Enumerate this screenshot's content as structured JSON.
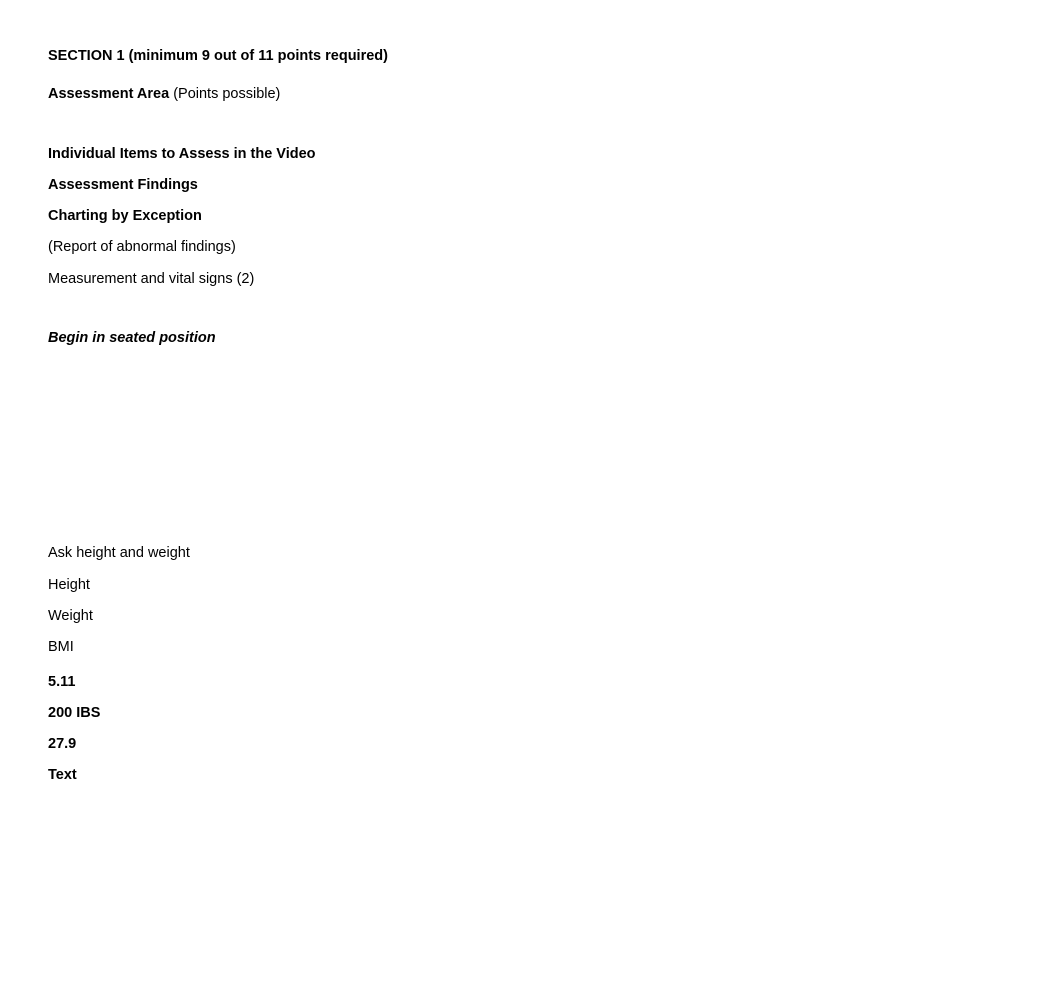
{
  "section_title": "SECTION 1 (minimum 9 out of 11 points required)",
  "assessment_area_label": "Assessment Area",
  "points_possible_label": " (Points possible)",
  "individual_items_label": "Individual Items to Assess in the Video",
  "assessment_findings_label": "Assessment Findings",
  "charting_exception_label": "Charting by Exception",
  "report_abnormal_label": "(Report of abnormal findings)",
  "measurement_vitals_label": "Measurement and vital signs (2)",
  "begin_position_label": "Begin in seated position",
  "ask_height_weight_label": "Ask height and weight",
  "fields": {
    "height_label": "Height",
    "weight_label": "Weight",
    "bmi_label": "BMI"
  },
  "values": {
    "height": "5.11",
    "weight": "200 IBS",
    "bmi": "27.9",
    "text_label": "Text"
  }
}
